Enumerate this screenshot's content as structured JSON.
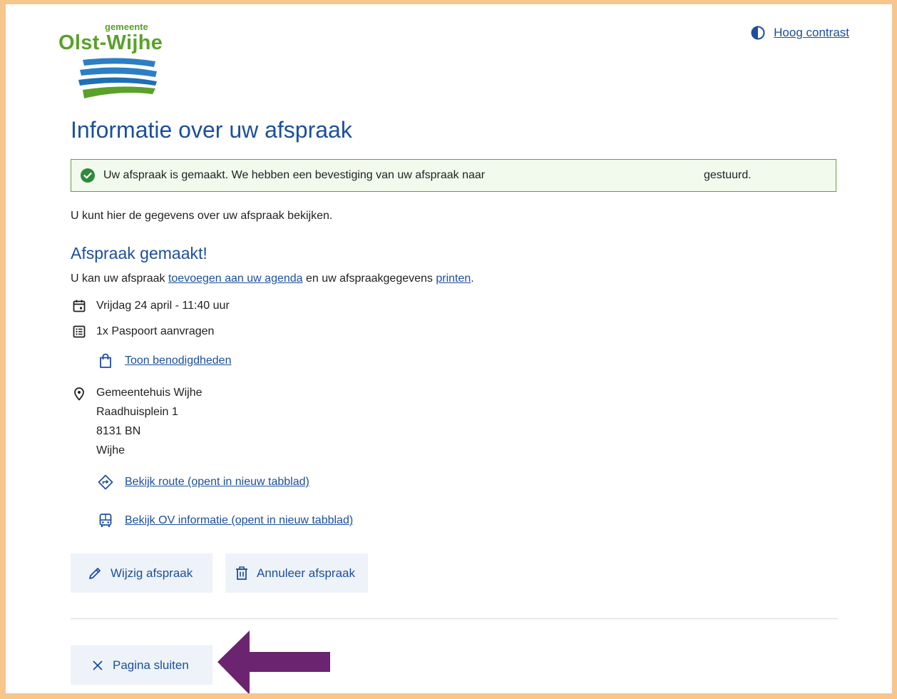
{
  "logo": {
    "small": "gemeente",
    "big": "Olst-Wijhe"
  },
  "header": {
    "contrast_label": "Hoog contrast"
  },
  "page_title": "Informatie over uw afspraak",
  "alert": {
    "message": "Uw afspraak is gemaakt. We hebben een bevestiging van uw afspraak naar",
    "suffix": "gestuurd."
  },
  "intro_text": "U kunt hier de gegevens over uw afspraak bekijken.",
  "section_title": "Afspraak gemaakt!",
  "add_line": {
    "before": "U kan uw afspraak ",
    "agenda_link": "toevoegen aan uw agenda",
    "middle": " en uw afspraakgegevens ",
    "print_link": "printen",
    "after": "."
  },
  "appointment": {
    "datetime": "Vrijdag 24 april - 11:40 uur",
    "product": "1x Paspoort aanvragen",
    "requirements_link": "Toon benodigdheden",
    "location": [
      "Gemeentehuis Wijhe",
      "Raadhuisplein 1",
      "8131 BN",
      "Wijhe"
    ],
    "route_link": "Bekijk route (opent in nieuw tabblad)",
    "ov_link": "Bekijk OV informatie (opent in nieuw tabblad)"
  },
  "actions": {
    "edit": "Wijzig afspraak",
    "cancel": "Annuleer afspraak",
    "close": "Pagina sluiten"
  },
  "colors": {
    "accent": "#1c4f9c",
    "success": "#5ca33b",
    "frame": "#f6c68c",
    "annotation_arrow": "#6b2470"
  }
}
